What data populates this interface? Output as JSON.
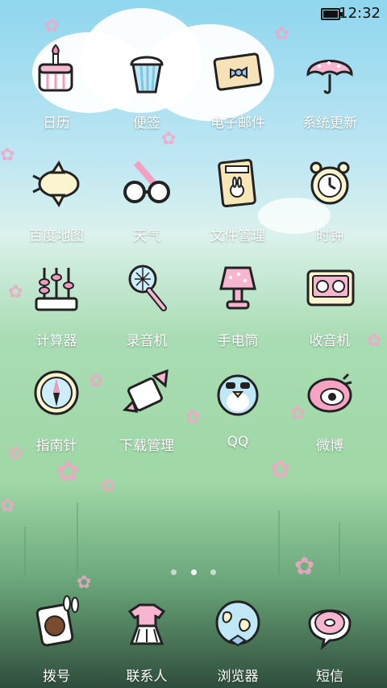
{
  "status_bar": {
    "time": "12:32",
    "battery_level_pct": 100
  },
  "apps": [
    {
      "label": "日历",
      "icon": "calendar-cake-icon"
    },
    {
      "label": "便签",
      "icon": "notes-cupcake-icon"
    },
    {
      "label": "电子邮件",
      "icon": "mail-envelope-icon"
    },
    {
      "label": "系统更新",
      "icon": "update-umbrella-icon"
    },
    {
      "label": "百度地图",
      "icon": "map-plane-icon"
    },
    {
      "label": "天气",
      "icon": "weather-glasses-icon"
    },
    {
      "label": "文件管理",
      "icon": "file-book-icon"
    },
    {
      "label": "时钟",
      "icon": "alarm-clock-icon"
    },
    {
      "label": "计算器",
      "icon": "abacus-icon"
    },
    {
      "label": "录音机",
      "icon": "microphone-icon"
    },
    {
      "label": "手电筒",
      "icon": "lamp-icon"
    },
    {
      "label": "收音机",
      "icon": "radio-cassette-icon"
    },
    {
      "label": "指南针",
      "icon": "compass-icon"
    },
    {
      "label": "下载管理",
      "icon": "download-candy-icon"
    },
    {
      "label": "QQ",
      "icon": "qq-penguin-icon"
    },
    {
      "label": "微博",
      "icon": "weibo-bird-icon"
    }
  ],
  "page_indicator": {
    "count": 3,
    "active": 2
  },
  "dock": [
    {
      "label": "拨号",
      "icon": "phone-bunny-icon"
    },
    {
      "label": "联系人",
      "icon": "contacts-dress-icon"
    },
    {
      "label": "浏览器",
      "icon": "browser-globe-icon"
    },
    {
      "label": "短信",
      "icon": "sms-donut-icon"
    }
  ]
}
